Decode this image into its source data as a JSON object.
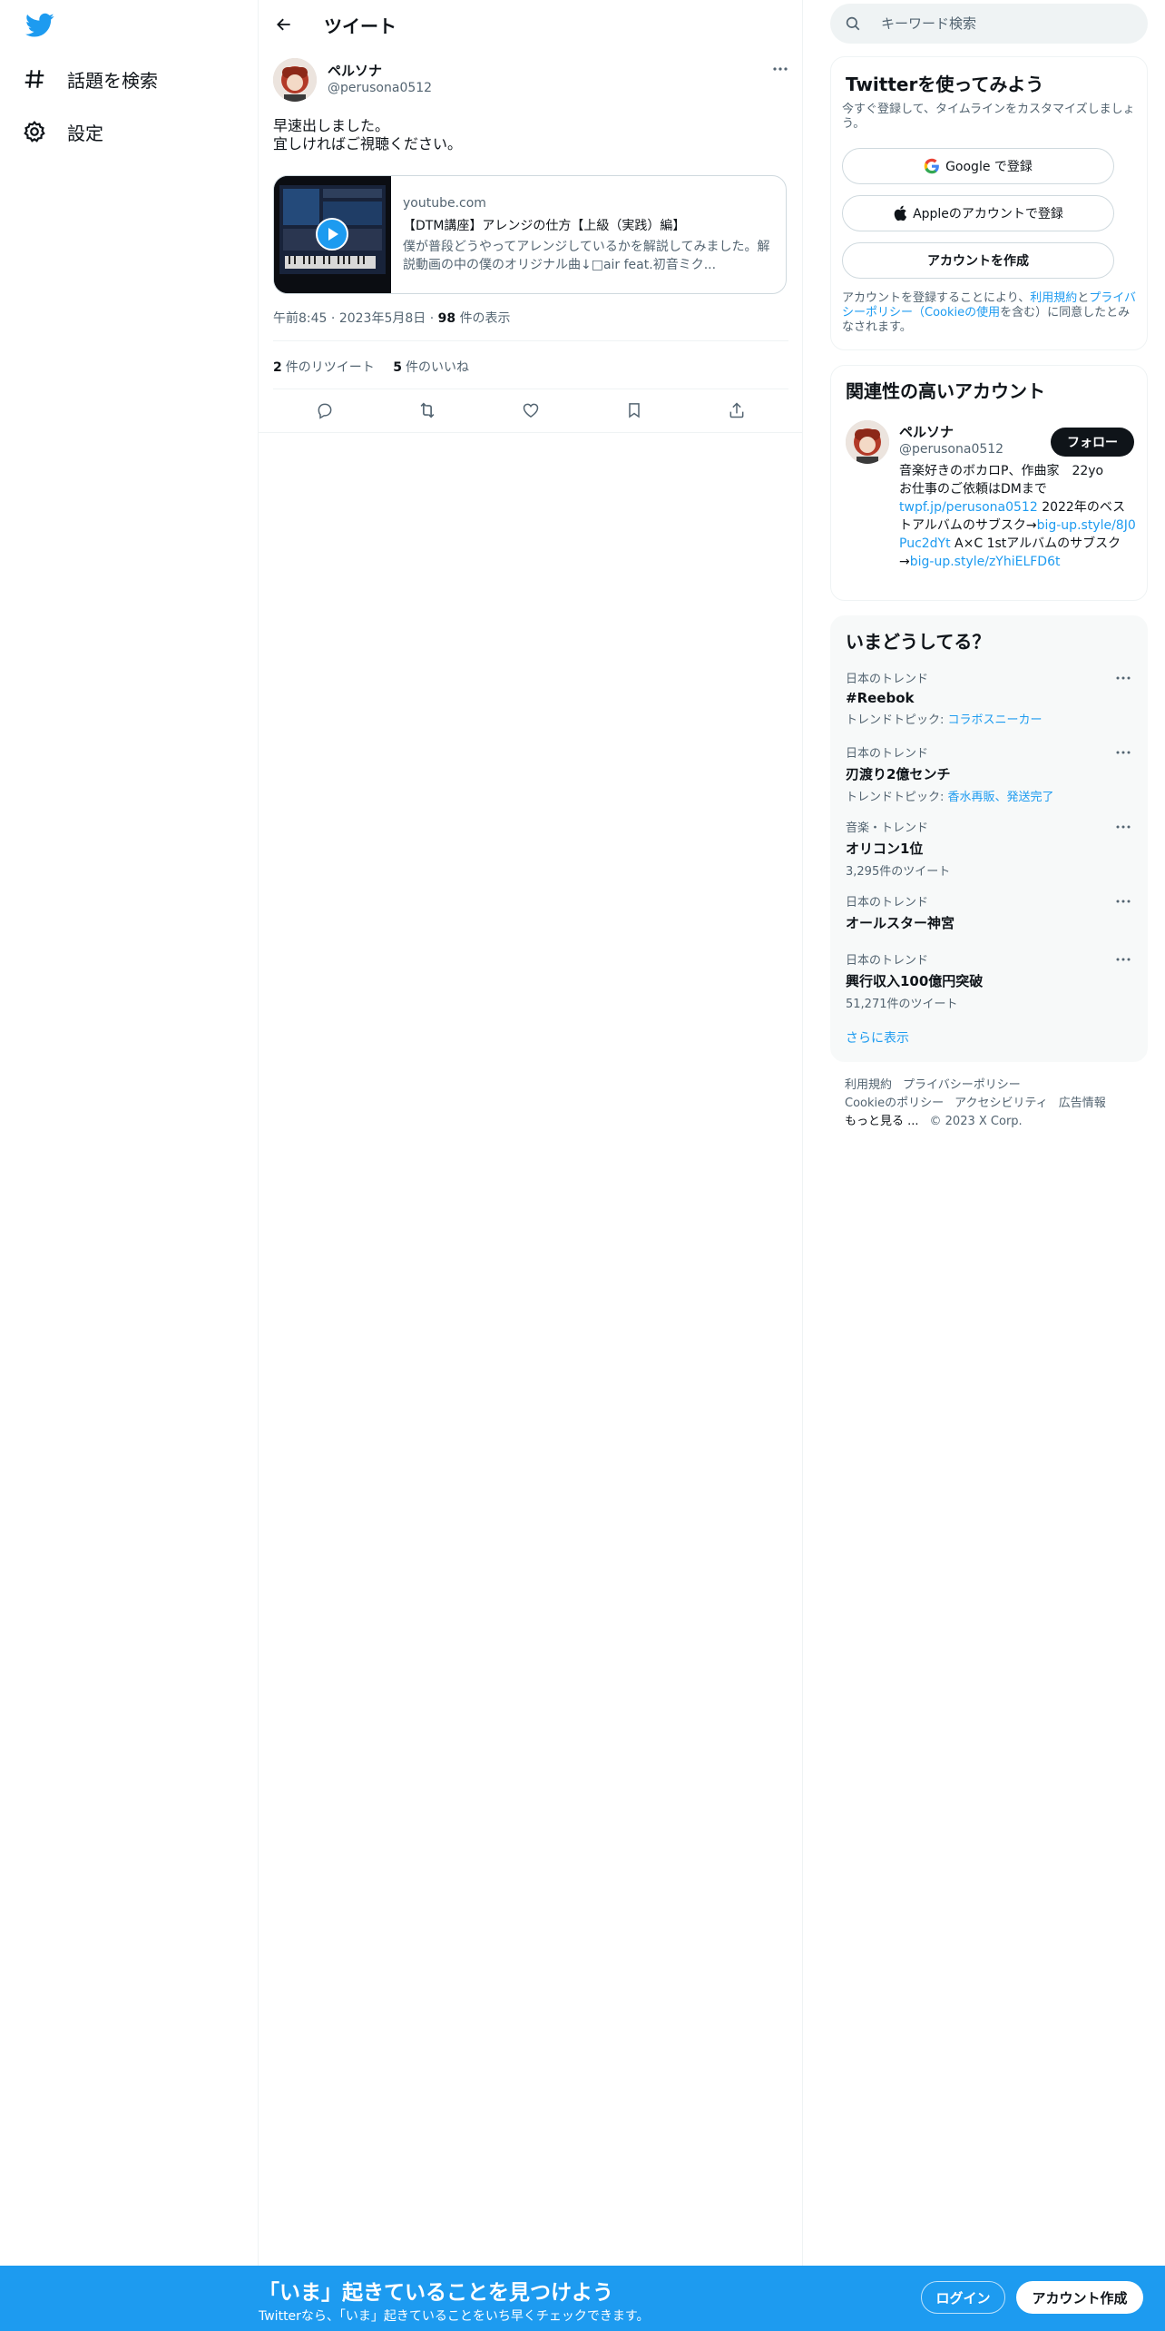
{
  "nav": {
    "logo_icon": "twitter-bird-icon",
    "items": [
      {
        "label": "話題を検索",
        "icon": "hashtag-icon"
      },
      {
        "label": "設定",
        "icon": "gear-icon"
      }
    ]
  },
  "header": {
    "title": "ツイート"
  },
  "tweet": {
    "author_name": "ペルソナ",
    "author_handle": "@perusona0512",
    "text_line1": "早速出しました。",
    "text_line2": "宜しければご視聴ください。",
    "card": {
      "domain": "youtube.com",
      "title": "【DTM講座】アレンジの仕方【上級（実践）編】",
      "description": "僕が普段どうやってアレンジしているかを解説してみました。解説動画の中の僕のオリジナル曲↓□air feat.初音ミク..."
    },
    "time": "午前8:45",
    "date": "2023年5月8日",
    "views_count": "98",
    "views_label": "件の表示",
    "retweets_count": "2",
    "retweets_label": "件のリツイート",
    "likes_count": "5",
    "likes_label": "件のいいね"
  },
  "search": {
    "placeholder": "キーワード検索"
  },
  "signup_panel": {
    "title": "Twitterを使ってみよう",
    "subtitle": "今すぐ登録して、タイムラインをカスタマイズしましょう。",
    "google_button": "Google で登録",
    "apple_button": "Appleのアカウントで登録",
    "create_button": "アカウントを作成",
    "terms_prefix": "アカウントを登録することにより、",
    "terms_link": "利用規約",
    "terms_and": "と",
    "privacy_link": "プライバシーポリシー",
    "cookie_link": "（Cookieの使用",
    "terms_suffix": "を含む）に同意したとみなされます。"
  },
  "related_panel": {
    "title": "関連性の高いアカウント",
    "name": "ペルソナ",
    "handle": "@perusona0512",
    "follow_button": "フォロー",
    "bio_line1": "音楽好きのボカロP、作曲家　22yo",
    "bio_line2": "お仕事のご依頼はDMまで",
    "bio_link1": "twpf.jp/perusona0512",
    "bio_text2": " 2022年のベストアルバムのサブスク→",
    "bio_link2": "big-up.style/8J0Puc2dYt",
    "bio_text3": " A×C 1stアルバムのサブスク→",
    "bio_link3": "big-up.style/zYhiELFD6t"
  },
  "trends_panel": {
    "title": "いまどうしてる？",
    "trends": [
      {
        "context": "日本のトレンド",
        "name": "#Reebok",
        "sub_prefix": "トレンドトピック: ",
        "sub_link": "コラボスニーカー"
      },
      {
        "context": "日本のトレンド",
        "name": "刃渡り2億センチ",
        "sub_prefix": "トレンドトピック: ",
        "sub_link": "香水再販、発送完了"
      },
      {
        "context": "音楽・トレンド",
        "name": "オリコン1位",
        "sub_prefix": "3,295件のツイート",
        "sub_link": ""
      },
      {
        "context": "日本のトレンド",
        "name": "オールスター神宮",
        "sub_prefix": "",
        "sub_link": ""
      },
      {
        "context": "日本のトレンド",
        "name": "興行収入100億円突破",
        "sub_prefix": "51,271件のツイート",
        "sub_link": ""
      }
    ],
    "show_more": "さらに表示"
  },
  "footer": {
    "links": [
      "利用規約",
      "プライバシーポリシー",
      "Cookieのポリシー",
      "アクセシビリティ",
      "広告情報",
      "もっと見る ..."
    ],
    "copyright": "© 2023 X Corp."
  },
  "bottom_bar": {
    "title": "「いま」起きていることを見つけよう",
    "subtitle": "Twitterなら、「いま」起きていることをいち早くチェックできます。",
    "login_button": "ログイン",
    "signup_button": "アカウント作成"
  },
  "colors": {
    "accent": "#1d9bf0",
    "text": "#0f1419",
    "secondary": "#536471",
    "border": "#eff3f4"
  }
}
